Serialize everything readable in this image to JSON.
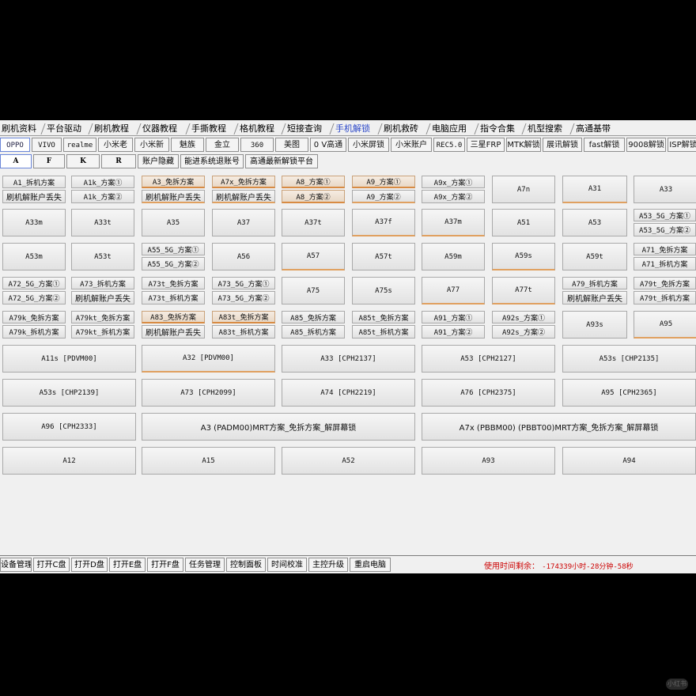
{
  "menu_tabs": [
    "刷机资料",
    "平台驱动",
    "刷机教程",
    "仪器教程",
    "手撕教程",
    "格机教程",
    "短接查询",
    "手机解锁",
    "刷机救砖",
    "电脑应用",
    "指令合集",
    "机型搜索",
    "高通基带"
  ],
  "active_menu_tab": "手机解锁",
  "brand_tabs": [
    "OPPO",
    "VIVO",
    "realme",
    "小米老",
    "小米新",
    "魅族",
    "金立",
    "360",
    "美图",
    "0 V高通",
    "小米屏锁",
    "小米账户",
    "REC5.0",
    "三星FRP",
    "MTK解锁",
    "展讯解锁",
    "fast解锁",
    "9008解锁",
    "ISP解锁"
  ],
  "active_brand": "OPPO",
  "sub_tabs": [
    "A",
    "F",
    "K",
    "R",
    "账户隐藏",
    "能进系统退账号",
    "高通最新解锁平台"
  ],
  "active_sub_tab": "A",
  "buttons": {
    "b1a": "A1_拆机方案",
    "b1b": "刷机解账户丢失",
    "b2a": "A1k_方案①",
    "b2b": "A1k_方案②",
    "b3a": "A3_免拆方案",
    "b3b": "刷机解账户丢失",
    "b4a": "A7x_免拆方案",
    "b4b": "刷机解账户丢失",
    "b5a": "A8_方案①",
    "b5b": "A8_方案②",
    "b6a": "A9_方案①",
    "b6b": "A9_方案②",
    "b7a": "A9x_方案①",
    "b7b": "A9x_方案②",
    "b8": "A7n",
    "b9": "A31",
    "b10": "A33",
    "c1": "A33m",
    "c2": "A33t",
    "c3": "A35",
    "c4": "A37",
    "c5": "A37t",
    "c6": "A37f",
    "c7": "A37m",
    "c8": "A51",
    "c9": "A53",
    "c10a": "A53_5G_方案①",
    "c10b": "A53_5G_方案②",
    "d1": "A53m",
    "d2": "A53t",
    "d3a": "A55_5G_方案①",
    "d3b": "A55_5G_方案②",
    "d4": "A56",
    "d5": "A57",
    "d6": "A57t",
    "d7": "A59m",
    "d8": "A59s",
    "d9": "A59t",
    "d10a": "A71_免拆方案",
    "d10b": "A71_拆机方案",
    "e1a": "A72_5G_方案①",
    "e1b": "A72_5G_方案②",
    "e2a": "A73_拆机方案",
    "e2b": "刷机解账户丢失",
    "e3a": "A73t_免拆方案",
    "e3b": "A73t_拆机方案",
    "e4a": "A73_5G_方案①",
    "e4b": "A73_5G_方案②",
    "e5": "A75",
    "e6": "A75s",
    "e7": "A77",
    "e8": "A77t",
    "e9a": "A79_拆机方案",
    "e9b": "刷机解账户丢失",
    "e10a": "A79t_免拆方案",
    "e10b": "A79t_拆机方案",
    "f1a": "A79k_免拆方案",
    "f1b": "A79k_拆机方案",
    "f2a": "A79kt_免拆方案",
    "f2b": "A79kt_拆机方案",
    "f3a": "A83_免拆方案",
    "f3b": "刷机解账户丢失",
    "f4a": "A83t_免拆方案",
    "f4b": "A83t_拆机方案",
    "f5a": "A85_免拆方案",
    "f5b": "A85_拆机方案",
    "f6a": "A85t_免拆方案",
    "f6b": "A85t_拆机方案",
    "f7a": "A91_方案①",
    "f7b": "A91_方案②",
    "f8a": "A92s_方案①",
    "f8b": "A92s_方案②",
    "f9": "A93s",
    "f10": "A95",
    "g1": "A11s [PDVM00]",
    "g2": "A32 [PDVM00]",
    "g3": "A33 [CPH2137]",
    "g4": "A53 [CPH2127]",
    "g5": "A53s [CHP2135]",
    "h1": "A53s [CHP2139]",
    "h2": "A73 [CPH2099]",
    "h3": "A74 [CPH2219]",
    "h4": "A76 [CPH2375]",
    "h5": "A95 [CPH2365]",
    "i1": "A96 [CPH2333]",
    "i2": "A3 (PADM00)MRT方案_免拆方案_解屏幕锁",
    "i3": "A7x (PBBM00) (PBBT00)MRT方案_免拆方案_解屏幕锁",
    "j1": "A12",
    "j2": "A15",
    "j3": "A52",
    "j4": "A93",
    "j5": "A94"
  },
  "status_buttons": [
    "设备管理",
    "打开C盘",
    "打开D盘",
    "打开E盘",
    "打开F盘",
    "任务管理",
    "控制面板",
    "时间校准",
    "主控升级",
    "重启电脑"
  ],
  "timer_label": "使用时间剩余：",
  "timer_value": "-174339小时-28分钟-58秒",
  "watermark_badge": "小红书",
  "colors": {
    "accent_underline": "#e0a060",
    "timer_text": "#cc0000",
    "active_tab_text": "#2a46c8"
  }
}
